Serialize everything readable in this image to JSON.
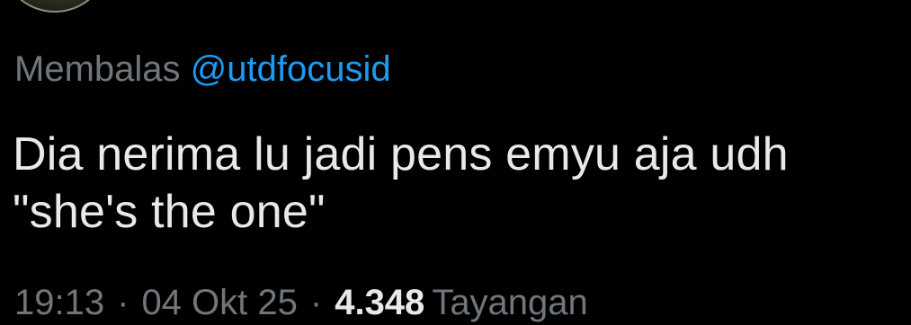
{
  "reply": {
    "prefix": "Membalas",
    "handle": "@utdfocusid"
  },
  "tweet": {
    "text": "Dia nerima lu jadi pens emyu aja udh\n\"she's the one\""
  },
  "meta": {
    "time": "19:13",
    "separator": "·",
    "date": "04 Okt 25",
    "views_count": "4.348",
    "views_label": "Tayangan"
  },
  "colors": {
    "background": "#000000",
    "text": "#e7e9ea",
    "muted": "#71767b",
    "link": "#1d9bf0"
  }
}
